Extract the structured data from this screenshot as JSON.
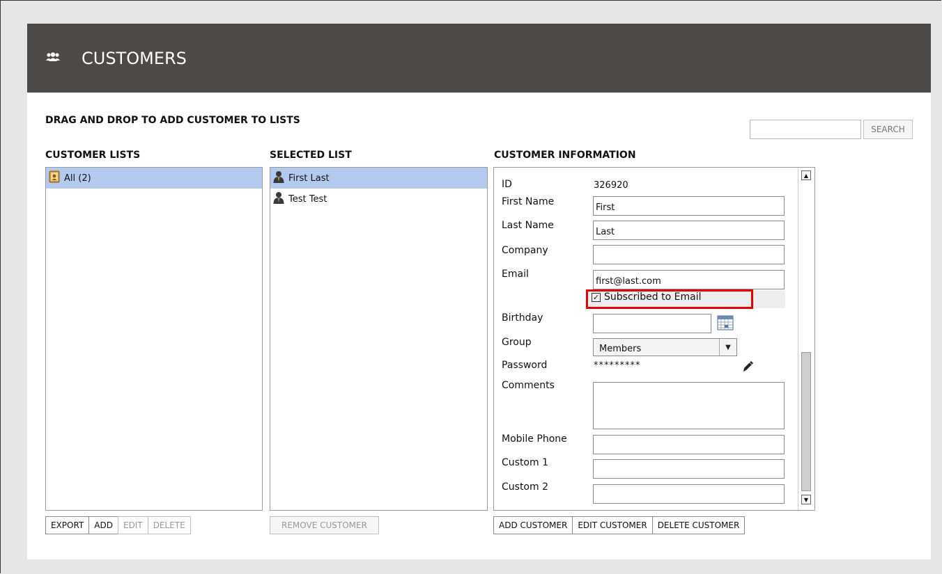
{
  "header": {
    "title": "CUSTOMERS",
    "icon": "people-icon"
  },
  "instruction": "DRAG AND DROP TO ADD CUSTOMER TO LISTS",
  "search": {
    "value": "",
    "placeholder": "",
    "button_label": "SEARCH"
  },
  "customer_lists": {
    "label": "CUSTOMER LISTS",
    "items": [
      {
        "label": "All (2)",
        "icon": "address-book-icon",
        "selected": true
      }
    ],
    "buttons": {
      "export": "EXPORT",
      "add": "ADD",
      "edit": "EDIT",
      "delete": "DELETE"
    }
  },
  "selected_list": {
    "label": "SELECTED LIST",
    "items": [
      {
        "label": "First Last",
        "icon": "person-icon",
        "selected": true
      },
      {
        "label": "Test Test",
        "icon": "person-icon",
        "selected": false
      }
    ],
    "buttons": {
      "remove": "REMOVE CUSTOMER"
    }
  },
  "customer_info": {
    "label": "CUSTOMER INFORMATION",
    "fields": {
      "id": {
        "label": "ID",
        "value": "326920"
      },
      "first_name": {
        "label": "First Name",
        "value": "First"
      },
      "last_name": {
        "label": "Last Name",
        "value": "Last"
      },
      "company": {
        "label": "Company",
        "value": ""
      },
      "email": {
        "label": "Email",
        "value": "first@last.com"
      },
      "subscribed": {
        "label": "Subscribed to Email",
        "checked": true
      },
      "birthday": {
        "label": "Birthday",
        "value": ""
      },
      "group": {
        "label": "Group",
        "value": "Members"
      },
      "password": {
        "label": "Password",
        "value": "*********"
      },
      "comments": {
        "label": "Comments",
        "value": ""
      },
      "mobile_phone": {
        "label": "Mobile Phone",
        "value": ""
      },
      "custom1": {
        "label": "Custom 1",
        "value": ""
      },
      "custom2": {
        "label": "Custom 2",
        "value": ""
      }
    },
    "buttons": {
      "add": "ADD CUSTOMER",
      "edit": "EDIT CUSTOMER",
      "delete": "DELETE CUSTOMER"
    }
  },
  "colors": {
    "header_bg": "#4d4946",
    "selection": "#b4c9ee",
    "highlight": "#e60000",
    "page_bg": "#e6e6e6"
  }
}
